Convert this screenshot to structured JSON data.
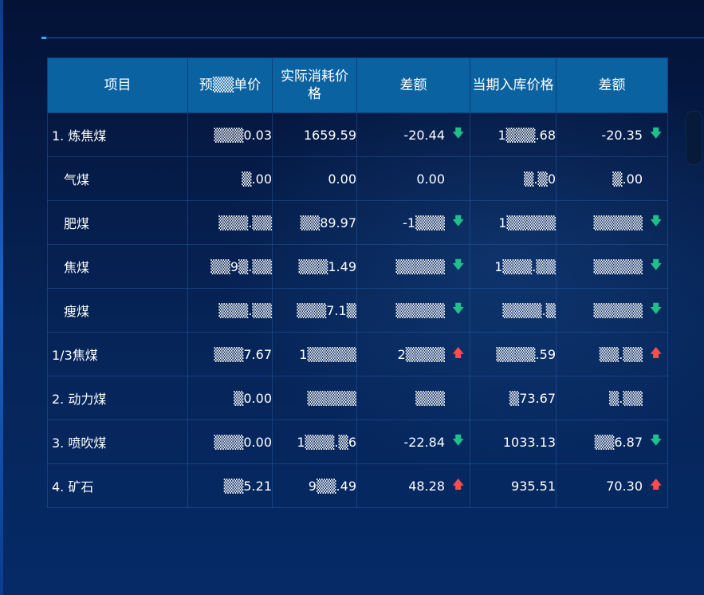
{
  "table": {
    "headers": [
      "项目",
      "预▒▒单价",
      "实际消耗价格",
      "差额",
      "当期入库价格",
      "差额"
    ],
    "rows": [
      {
        "name": "1. 炼焦煤",
        "c1": "▒▒▒0.03",
        "c2": "1659.59",
        "c3": "-20.44",
        "c3_dir": "down",
        "c4": "1▒▒▒.68",
        "c5": "-20.35",
        "c5_dir": "down"
      },
      {
        "name": "气煤",
        "c1": "▒.00",
        "c2": "0.00",
        "c3": "0.00",
        "c3_dir": "",
        "c4": "▒.▒0",
        "c5": "▒.00",
        "c5_dir": ""
      },
      {
        "name": "肥煤",
        "c1": "▒▒▒.▒▒",
        "c2": "▒▒89.97",
        "c3": "-1▒▒▒",
        "c3_dir": "down",
        "c4": "1▒▒▒▒▒",
        "c5": "▒▒▒▒▒",
        "c5_dir": "down"
      },
      {
        "name": "焦煤",
        "c1": "▒▒9▒.▒▒",
        "c2": "▒▒▒1.49",
        "c3": "▒▒▒▒▒",
        "c3_dir": "down",
        "c4": "1▒▒▒.▒▒",
        "c5": "▒▒▒▒▒",
        "c5_dir": "down"
      },
      {
        "name": "瘦煤",
        "c1": "▒▒▒.▒▒",
        "c2": "▒▒▒7.1▒",
        "c3": "▒▒▒▒▒",
        "c3_dir": "down",
        "c4": "▒▒▒▒.▒",
        "c5": "▒▒▒▒▒",
        "c5_dir": "down"
      },
      {
        "name": "1/3焦煤",
        "c1": "▒▒▒7.67",
        "c2": "1▒▒▒▒▒",
        "c3": "2▒▒▒▒",
        "c3_dir": "up",
        "c4": "▒▒▒▒.59",
        "c5": "▒▒.▒▒",
        "c5_dir": "up"
      },
      {
        "name": "2. 动力煤",
        "c1": "▒0.00",
        "c2": "▒▒▒▒▒",
        "c3": "▒▒▒",
        "c3_dir": "",
        "c4": "▒73.67",
        "c5": "▒.▒▒",
        "c5_dir": ""
      },
      {
        "name": "3. 喷吹煤",
        "c1": "▒▒▒0.00",
        "c2": "1▒▒▒.▒6",
        "c3": "-22.84",
        "c3_dir": "down",
        "c4": "1033.13",
        "c5": "▒▒6.87",
        "c5_dir": "down"
      },
      {
        "name": "4. 矿石",
        "c1": "▒▒5.21",
        "c2": "9▒▒.49",
        "c3": "48.28",
        "c3_dir": "up",
        "c4": "935.51",
        "c5": "70.30",
        "c5_dir": "up"
      }
    ]
  },
  "icons": {
    "down": "arrow-down-icon",
    "up": "arrow-up-icon"
  },
  "colors": {
    "header_bg": "#0a62a0",
    "down": "#1fc08a",
    "up": "#ff4d4d",
    "background": "#04153b"
  }
}
